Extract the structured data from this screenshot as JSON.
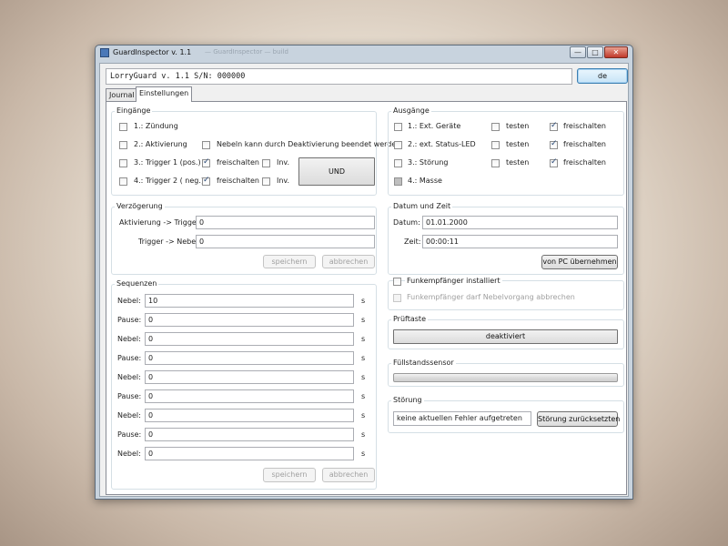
{
  "window": {
    "title": "GuardInspector v. 1.1",
    "ghost_title": "— GuardInspector — build",
    "minimize": "—",
    "maximize": "□",
    "close": "✕"
  },
  "header": {
    "serial_text": "LorryGuard v. 1.1 S/N: 000000",
    "language_button": "de"
  },
  "tabs": [
    "Journal",
    "Einstellungen"
  ],
  "eingaenge": {
    "title": "Eingänge",
    "items": [
      {
        "label": "1.: Zündung",
        "checked": false
      },
      {
        "label": "2.: Aktivierung",
        "checked": false
      },
      {
        "label": "3.: Trigger 1 (pos.)",
        "checked": false
      },
      {
        "label": "4.: Trigger 2 ( neg.)",
        "checked": false
      }
    ],
    "nebel_option": "Nebeln kann durch Deaktivierung beendet werden",
    "freischalten": "freischalten",
    "inv": "Inv.",
    "und_button": "UND"
  },
  "ausgaenge": {
    "title": "Ausgänge",
    "items": [
      {
        "label": "1.: Ext. Geräte",
        "testen": "testen",
        "freischalten": "freischalten"
      },
      {
        "label": "2.: ext. Status-LED",
        "testen": "testen",
        "freischalten": "freischalten"
      },
      {
        "label": "3.: Störung",
        "testen": "testen",
        "freischalten": "freischalten"
      },
      {
        "label": "4.: Masse"
      }
    ]
  },
  "verzoegerung": {
    "title": "Verzögerung",
    "rows": [
      {
        "label": "Aktivierung -> Trigger",
        "value": "0"
      },
      {
        "label": "Trigger -> Nebel",
        "value": "0"
      }
    ],
    "save": "speichern",
    "cancel": "abbrechen"
  },
  "datum": {
    "title": "Datum und Zeit",
    "date_label": "Datum:",
    "date_value": "01.01.2000",
    "time_label": "Zeit:",
    "time_value": "00:00:11",
    "pc_button": "von PC übernehmen"
  },
  "sequenzen": {
    "title": "Sequenzen",
    "unit": "s",
    "rows": [
      {
        "label": "Nebel:",
        "value": "10"
      },
      {
        "label": "Pause:",
        "value": "0"
      },
      {
        "label": "Nebel:",
        "value": "0"
      },
      {
        "label": "Pause:",
        "value": "0"
      },
      {
        "label": "Nebel:",
        "value": "0"
      },
      {
        "label": "Pause:",
        "value": "0"
      },
      {
        "label": "Nebel:",
        "value": "0"
      },
      {
        "label": "Pause:",
        "value": "0"
      },
      {
        "label": "Nebel:",
        "value": "0"
      }
    ],
    "save": "speichern",
    "cancel": "abbrechen"
  },
  "funk": {
    "installed": "Funkempfänger installiert",
    "abort": "Funkempfänger darf Nebelvorgang abbrechen"
  },
  "pruftaste": {
    "title": "Prüftaste",
    "button": "deaktiviert"
  },
  "fuellstand": {
    "title": "Füllstandssensor"
  },
  "stoerung": {
    "title": "Störung",
    "status": "keine aktuellen Fehler aufgetreten",
    "reset": "Störung zurücksetzten"
  },
  "colors": {
    "window_frame": "#c8d3de",
    "focus_blue": "#3c7fb1",
    "check_mark": "#2a4a78"
  }
}
